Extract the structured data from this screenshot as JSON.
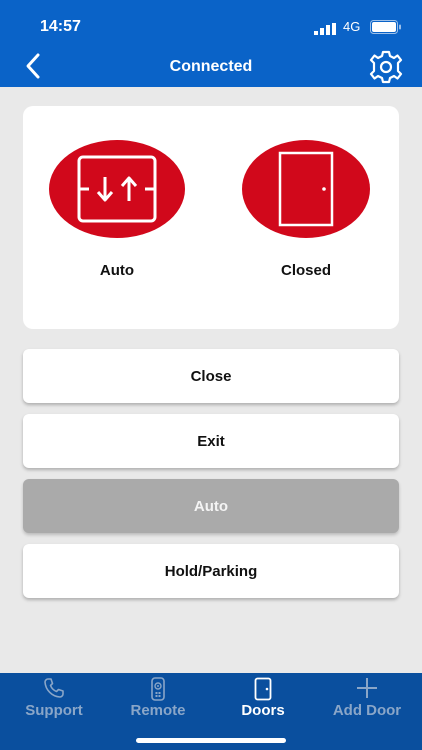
{
  "status_bar": {
    "time": "14:57",
    "network": "4G"
  },
  "header": {
    "title": "Connected"
  },
  "door_status": {
    "mode": {
      "label": "Auto"
    },
    "door": {
      "label": "Closed"
    }
  },
  "commands": [
    {
      "label": "Close",
      "selected": false
    },
    {
      "label": "Exit",
      "selected": false
    },
    {
      "label": "Auto",
      "selected": true
    },
    {
      "label": "Hold/Parking",
      "selected": false
    }
  ],
  "tabs": [
    {
      "label": "Support",
      "icon": "phone-icon",
      "active": false
    },
    {
      "label": "Remote",
      "icon": "remote-icon",
      "active": false
    },
    {
      "label": "Doors",
      "icon": "door-icon",
      "active": true
    },
    {
      "label": "Add Door",
      "icon": "plus-icon",
      "active": false
    }
  ],
  "colors": {
    "header": "#0a63c8",
    "tabbar": "#0a4f9e",
    "status_red": "#d1081b",
    "selected_button": "#aaaaaa"
  }
}
